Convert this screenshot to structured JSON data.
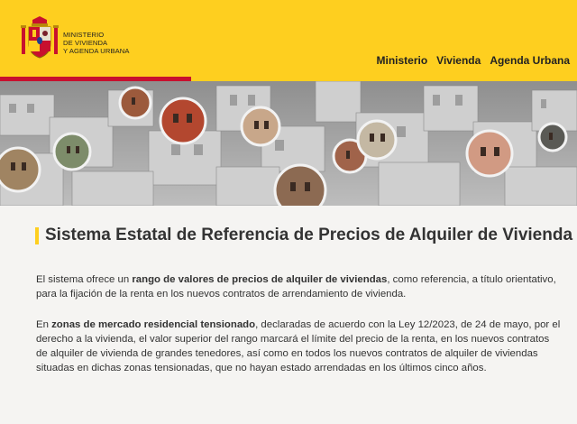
{
  "header": {
    "ministry_lines": [
      "MINISTERIO",
      "DE VIVIENDA",
      "Y AGENDA URBANA"
    ],
    "nav": [
      "Ministerio",
      "Vivienda",
      "Agenda Urbana"
    ],
    "colors": {
      "yellow": "#fecf1f",
      "red": "#c8102e"
    }
  },
  "hero": {
    "icon": "city-rooftops-image"
  },
  "main": {
    "title": "Sistema Estatal de Referencia de Precios de Alquiler de Vivienda",
    "p1": {
      "a": "El sistema ofrece un ",
      "b": "rango de valores de precios de alquiler de viviendas",
      "c": ", como referencia, a título orientativo,",
      "d": "para la fijación de la renta en los nuevos contratos de arrendamiento de vivienda."
    },
    "p2": {
      "a": "En ",
      "b": "zonas de mercado residencial tensionado",
      "c": ", declaradas de acuerdo con la Ley 12/2023, de 24 de mayo, por el",
      "l2": "derecho a la vivienda, el valor superior del rango marcará el límite del precio de la renta, en los nuevos contratos",
      "l3": "de alquiler de vivienda de grandes tenedores, así como en todos los nuevos contratos de alquiler de viviendas",
      "l4": "situadas en dichas zonas tensionadas, que no hayan estado arrendadas en los últimos cinco años."
    }
  }
}
